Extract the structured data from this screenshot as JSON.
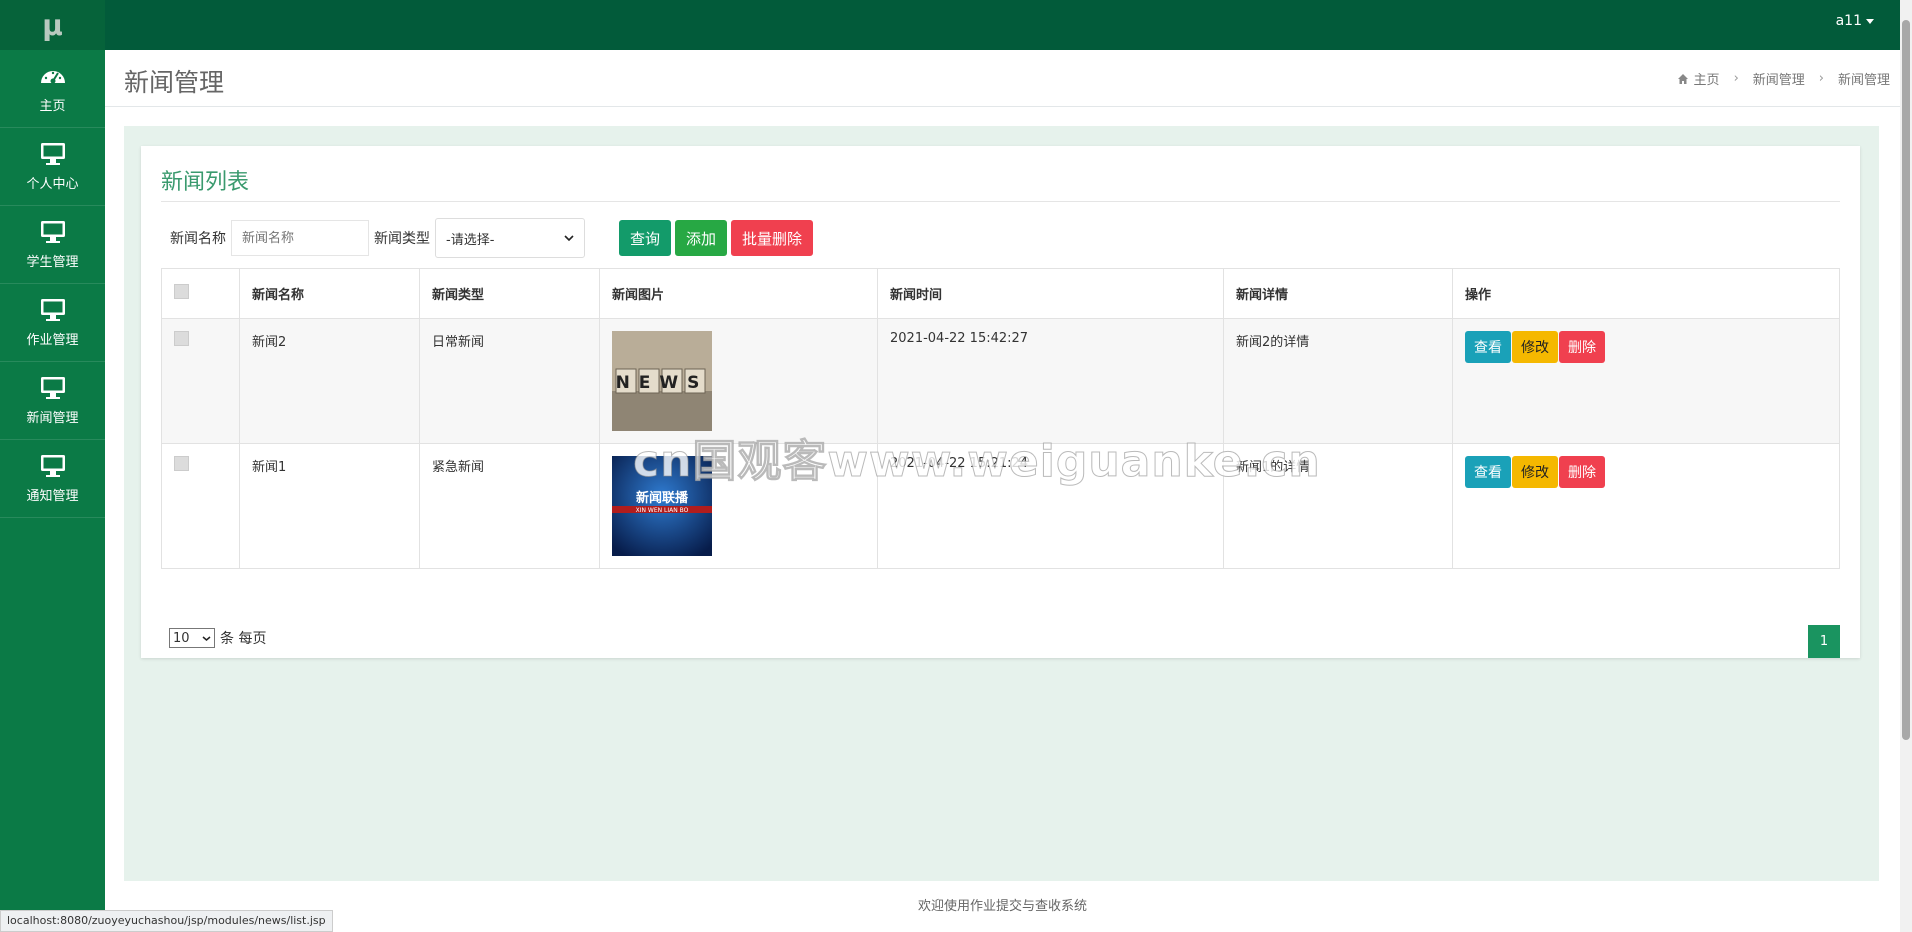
{
  "sidebar": {
    "logo": "μ",
    "items": [
      {
        "label": "主页",
        "icon": "dashboard-icon"
      },
      {
        "label": "个人中心",
        "icon": "monitor-icon"
      },
      {
        "label": "学生管理",
        "icon": "monitor-icon"
      },
      {
        "label": "作业管理",
        "icon": "monitor-icon"
      },
      {
        "label": "新闻管理",
        "icon": "monitor-icon"
      },
      {
        "label": "通知管理",
        "icon": "monitor-icon"
      }
    ]
  },
  "topbar": {
    "user": "a11"
  },
  "header": {
    "title": "新闻管理",
    "breadcrumb": [
      "主页",
      "新闻管理",
      "新闻管理"
    ]
  },
  "card": {
    "title": "新闻列表",
    "search": {
      "name_label": "新闻名称",
      "name_placeholder": "新闻名称",
      "type_label": "新闻类型",
      "type_selected": "-请选择-"
    },
    "buttons": {
      "query": "查询",
      "add": "添加",
      "batch_delete": "批量删除"
    }
  },
  "table": {
    "headers": [
      "新闻名称",
      "新闻类型",
      "新闻图片",
      "新闻时间",
      "新闻详情",
      "操作"
    ],
    "rows": [
      {
        "name": "新闻2",
        "type": "日常新闻",
        "image": "NEWS",
        "time": "2021-04-22 15:42:27",
        "detail": "新闻2的详情"
      },
      {
        "name": "新闻1",
        "type": "紧急新闻",
        "image": "新闻联播",
        "image_sub": "XIN WEN LIAN BO",
        "time": "2021-04-22 15:21:24",
        "detail": "新闻1的详情"
      }
    ],
    "actions": {
      "view": "查看",
      "edit": "修改",
      "delete": "删除"
    }
  },
  "pagination": {
    "per_page": "10",
    "per_page_label": "条 每页",
    "current_page": "1"
  },
  "footer": {
    "text": "欢迎使用作业提交与查收系统"
  },
  "status_url": "localhost:8080/zuoyeyuchashou/jsp/modules/news/list.jsp",
  "watermark": "cn国观客www.weiguanke.cn",
  "colors": {
    "sidebar": "#0b7a46",
    "topbar": "#025b3a",
    "accent": "#3a9a6e",
    "danger": "#f0404f",
    "warning": "#f5b800",
    "info": "#1aa1b8"
  }
}
